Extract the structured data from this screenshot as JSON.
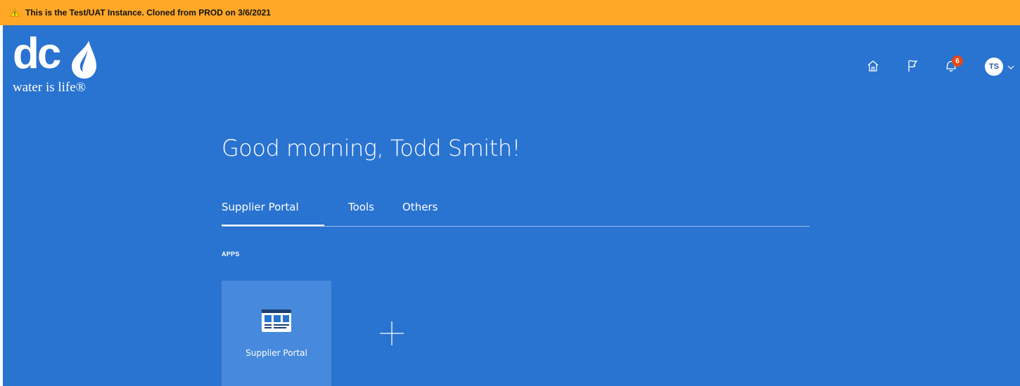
{
  "banner": {
    "text": "This is the Test/UAT Instance. Cloned from PROD on 3/6/2021",
    "icon": "warning-icon",
    "color": "#ffa828"
  },
  "logo": {
    "text": "dc",
    "tagline": "water is life®",
    "icon": "water-drop-icon"
  },
  "header": {
    "home_icon": "home-icon",
    "favorites_icon": "flag-icon",
    "notifications_icon": "bell-icon",
    "notifications_count": "6",
    "user_initials": "TS",
    "menu_icon": "chevron-down-icon"
  },
  "greeting": "Good morning, Todd Smith!",
  "tabs": [
    {
      "label": "Supplier Portal",
      "active": true
    },
    {
      "label": "Tools",
      "active": false
    },
    {
      "label": "Others",
      "active": false
    }
  ],
  "apps": {
    "section_label": "APPS",
    "items": [
      {
        "label": "Supplier Portal",
        "icon": "supplier-portal-icon"
      }
    ],
    "add_icon": "plus-icon"
  },
  "colors": {
    "background": "#2973d1",
    "tile": "#4789dc",
    "badge": "#e24a1a"
  }
}
